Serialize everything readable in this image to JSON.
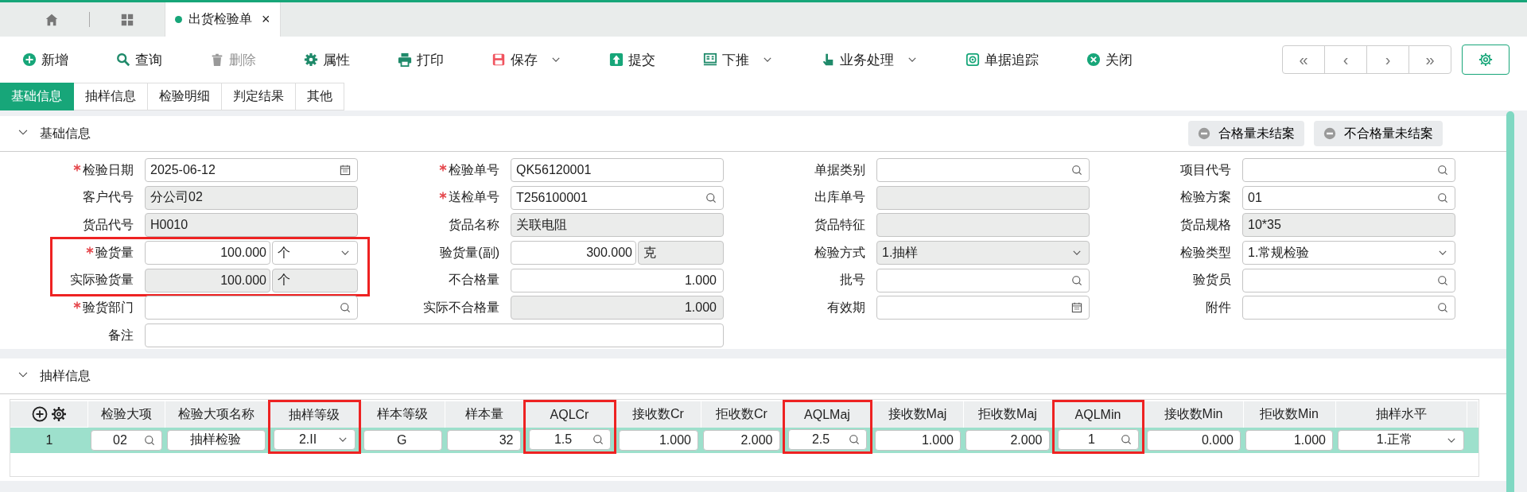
{
  "top_tabs": [
    {
      "kind": "home",
      "selected": false
    },
    {
      "kind": "grid",
      "selected": false
    },
    {
      "kind": "document",
      "label": "出货检验单",
      "close": "×",
      "selected": true
    }
  ],
  "toolbar": {
    "buttons": [
      {
        "label": "新增",
        "kind": "plus",
        "disabled": false,
        "dropdown": false
      },
      {
        "label": "查询",
        "kind": "search",
        "disabled": false,
        "dropdown": false
      },
      {
        "label": "删除",
        "kind": "trash",
        "disabled": true,
        "dropdown": false
      },
      {
        "label": "属性",
        "kind": "gear",
        "disabled": false,
        "dropdown": false
      },
      {
        "label": "打印",
        "kind": "printer",
        "disabled": false,
        "dropdown": false
      },
      {
        "label": "保存",
        "kind": "floppy",
        "disabled": false,
        "dropdown": true
      },
      {
        "label": "提交",
        "kind": "upload",
        "disabled": false,
        "dropdown": false
      },
      {
        "label": "下推",
        "kind": "document",
        "disabled": false,
        "dropdown": true
      },
      {
        "label": "业务处理",
        "kind": "hand",
        "disabled": false,
        "dropdown": true
      },
      {
        "label": "单据追踪",
        "kind": "crosshair",
        "disabled": false,
        "dropdown": false
      },
      {
        "label": "关闭",
        "kind": "close",
        "disabled": false,
        "dropdown": false
      }
    ],
    "nav": [
      "«",
      "‹",
      "›",
      "»"
    ]
  },
  "form_tabs": [
    {
      "label": "基础信息",
      "selected": true
    },
    {
      "label": "抽样信息",
      "selected": false
    },
    {
      "label": "检验明细",
      "selected": false
    },
    {
      "label": "判定结果",
      "selected": false
    },
    {
      "label": "其他",
      "selected": false
    }
  ],
  "basic": {
    "title": "基础信息",
    "expanded": true,
    "status_buttons": [
      "合格量未结案",
      "不合格量未结案"
    ],
    "columns": [
      {
        "fields": [
          {
            "label": "检验日期",
            "required": true,
            "kind": "date",
            "value": "2025-06-12",
            "disabled": false,
            "highlighted": false
          },
          {
            "label": "客户代号",
            "required": false,
            "kind": "text",
            "value": "分公司02",
            "disabled": true,
            "highlighted": false
          },
          {
            "label": "货品代号",
            "required": false,
            "kind": "text",
            "value": "H0010",
            "disabled": true,
            "highlighted": false
          },
          {
            "label": "验货量",
            "required": true,
            "kind": "quantity",
            "value": "100.000",
            "disabled": false,
            "unit": {
              "kind": "select",
              "value": "个",
              "disabled": false
            },
            "highlighted": true
          },
          {
            "label": "实际验货量",
            "required": false,
            "kind": "quantity",
            "value": "100.000",
            "disabled": true,
            "unit": {
              "kind": "text",
              "value": "个",
              "disabled": true
            },
            "highlighted": true
          },
          {
            "label": "验货部门",
            "required": true,
            "kind": "lookup",
            "disabled": false,
            "highlighted": false
          }
        ]
      },
      {
        "fields": [
          {
            "label": "检验单号",
            "required": true,
            "kind": "text",
            "value": "QK56120001",
            "disabled": false,
            "highlighted": false
          },
          {
            "label": "送检单号",
            "required": true,
            "kind": "lookup",
            "value": "T256100001",
            "disabled": false,
            "highlighted": false
          },
          {
            "label": "货品名称",
            "required": false,
            "kind": "text",
            "value": "关联电阻",
            "disabled": true,
            "highlighted": false
          },
          {
            "label": "验货量(副)",
            "required": false,
            "kind": "quantity",
            "value": "300.000",
            "disabled": false,
            "unit": {
              "kind": "text",
              "value": "克",
              "disabled": true
            },
            "highlighted": false
          },
          {
            "label": "不合格量",
            "required": false,
            "kind": "number",
            "value": "1.000",
            "disabled": false,
            "highlighted": false
          },
          {
            "label": "实际不合格量",
            "required": false,
            "kind": "number",
            "value": "1.000",
            "disabled": true,
            "highlighted": false
          }
        ]
      },
      {
        "fields": [
          {
            "label": "单据类别",
            "required": false,
            "kind": "lookup",
            "disabled": false,
            "highlighted": false
          },
          {
            "label": "出库单号",
            "required": false,
            "kind": "text",
            "disabled": true,
            "highlighted": false
          },
          {
            "label": "货品特征",
            "required": false,
            "kind": "text",
            "disabled": true,
            "highlighted": false
          },
          {
            "label": "检验方式",
            "required": false,
            "kind": "select",
            "value": "1.抽样",
            "disabled": true,
            "highlighted": false
          },
          {
            "label": "批号",
            "required": false,
            "kind": "lookup",
            "disabled": false,
            "highlighted": false
          },
          {
            "label": "有效期",
            "required": false,
            "kind": "date",
            "disabled": false,
            "highlighted": false
          }
        ]
      },
      {
        "fields": [
          {
            "label": "项目代号",
            "required": false,
            "kind": "lookup",
            "disabled": false,
            "highlighted": false
          },
          {
            "label": "检验方案",
            "required": false,
            "kind": "lookup",
            "value": "01",
            "disabled": false,
            "highlighted": false
          },
          {
            "label": "货品规格",
            "required": false,
            "kind": "text",
            "value": "10*35",
            "disabled": true,
            "highlighted": false
          },
          {
            "label": "检验类型",
            "required": false,
            "kind": "select",
            "value": "1.常规检验",
            "disabled": false,
            "highlighted": false
          },
          {
            "label": "验货员",
            "required": false,
            "kind": "lookup",
            "disabled": false,
            "highlighted": false
          },
          {
            "label": "附件",
            "required": false,
            "kind": "lookup",
            "disabled": false,
            "highlighted": false
          }
        ]
      }
    ],
    "notes": {
      "label": "备注",
      "required": false,
      "kind": "text",
      "disabled": false,
      "highlighted": false
    }
  },
  "sampling": {
    "title": "抽样信息",
    "expanded": true,
    "columns": [
      {
        "label": "检验大项",
        "highlighted": false
      },
      {
        "label": "检验大项名称",
        "highlighted": false
      },
      {
        "label": "抽样等级",
        "highlighted": true
      },
      {
        "label": "样本等级",
        "highlighted": false
      },
      {
        "label": "样本量",
        "highlighted": false
      },
      {
        "label": "AQLCr",
        "highlighted": true
      },
      {
        "label": "接收数Cr",
        "highlighted": false
      },
      {
        "label": "拒收数Cr",
        "highlighted": false
      },
      {
        "label": "AQLMaj",
        "highlighted": true
      },
      {
        "label": "接收数Maj",
        "highlighted": false
      },
      {
        "label": "拒收数Maj",
        "highlighted": false
      },
      {
        "label": "AQLMin",
        "highlighted": true
      },
      {
        "label": "接收数Min",
        "highlighted": false
      },
      {
        "label": "拒收数Min",
        "highlighted": false
      },
      {
        "label": "抽样水平",
        "highlighted": false
      }
    ],
    "rows": [
      {
        "number": "1",
        "selected": true,
        "cells": [
          {
            "kind": "lookup",
            "value": "02"
          },
          {
            "kind": "text",
            "value": "抽样检验"
          },
          {
            "kind": "select",
            "value": "2.II"
          },
          {
            "kind": "text",
            "value": "G"
          },
          {
            "kind": "number",
            "value": "32"
          },
          {
            "kind": "lookup",
            "value": "1.5"
          },
          {
            "kind": "number",
            "value": "1.000"
          },
          {
            "kind": "number",
            "value": "2.000"
          },
          {
            "kind": "lookup",
            "value": "2.5"
          },
          {
            "kind": "number",
            "value": "1.000"
          },
          {
            "kind": "number",
            "value": "2.000"
          },
          {
            "kind": "lookup",
            "value": "1"
          },
          {
            "kind": "number",
            "value": "0.000"
          },
          {
            "kind": "number",
            "value": "1.000"
          },
          {
            "kind": "select",
            "value": "1.正常"
          }
        ]
      }
    ]
  }
}
